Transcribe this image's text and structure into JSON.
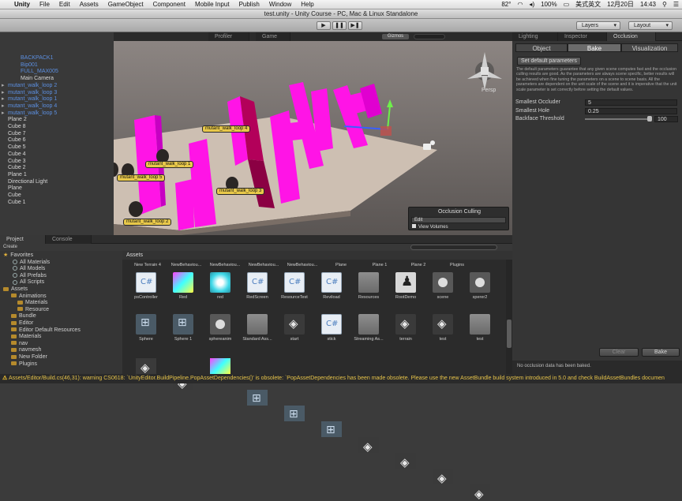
{
  "menubar": {
    "app": "Unity",
    "items": [
      "File",
      "Edit",
      "Assets",
      "GameObject",
      "Component",
      "Mobile Input",
      "Publish",
      "Window",
      "Help"
    ],
    "battery": "100%",
    "ime": "美式英文",
    "date": "12月20日",
    "time": "14:43",
    "temp": "82°"
  },
  "window": {
    "title": "test.unity - Unity Course - PC, Mac & Linux Standalone"
  },
  "toolbar": {
    "layers": "Layers",
    "layout": "Layout"
  },
  "hierarchy": {
    "items": [
      {
        "label": "BACKPACK1",
        "color": "blue",
        "indent": 1
      },
      {
        "label": "Bip001",
        "color": "blue",
        "indent": 1
      },
      {
        "label": "FULL_MAX005",
        "color": "blue",
        "indent": 1
      },
      {
        "label": "Main Camera",
        "color": "white",
        "indent": 1
      },
      {
        "label": "mutant_walk_loop 2",
        "color": "blue",
        "indent": 0
      },
      {
        "label": "mutant_walk_loop 3",
        "color": "blue",
        "indent": 0
      },
      {
        "label": "mutant_walk_loop 1",
        "color": "blue",
        "indent": 0
      },
      {
        "label": "mutant_walk_loop 4",
        "color": "blue",
        "indent": 0
      },
      {
        "label": "mutant_walk_loop 5",
        "color": "blue",
        "indent": 0
      },
      {
        "label": "Plane 2",
        "color": "white",
        "indent": 0
      },
      {
        "label": "Cube 8",
        "color": "white",
        "indent": 0
      },
      {
        "label": "Cube 7",
        "color": "white",
        "indent": 0
      },
      {
        "label": "Cube 6",
        "color": "white",
        "indent": 0
      },
      {
        "label": "Cube 5",
        "color": "white",
        "indent": 0
      },
      {
        "label": "Cube 4",
        "color": "white",
        "indent": 0
      },
      {
        "label": "Cube 3",
        "color": "white",
        "indent": 0
      },
      {
        "label": "Cube 2",
        "color": "white",
        "indent": 0
      },
      {
        "label": "Plane 1",
        "color": "white",
        "indent": 0
      },
      {
        "label": "Directional Light",
        "color": "white",
        "indent": 0
      },
      {
        "label": "Plane",
        "color": "white",
        "indent": 0
      },
      {
        "label": "Cube",
        "color": "white",
        "indent": 0
      },
      {
        "label": "Cube 1",
        "color": "white",
        "indent": 0
      }
    ]
  },
  "scene": {
    "tabs": [
      "Profiler",
      "Game"
    ],
    "gizmos": "Gizmos",
    "persp": "Persp",
    "labels": [
      "mutant_walk_loop 4",
      "mutant_walk_loop 1",
      "mutant_walk_loop 5",
      "mutant_walk_loop 3",
      "mutant_walk_loop 2"
    ],
    "occlusion": {
      "title": "Occlusion Culling",
      "mode": "Edit",
      "view_volumes": "View Volumes"
    }
  },
  "inspector": {
    "tabs": [
      "Lighting",
      "Inspector",
      "Occlusion"
    ],
    "subtabs": [
      "Object",
      "Bake",
      "Visualization"
    ],
    "set_default": "Set default parameters",
    "description": "The default parameters guarantee that any given scene computes fast and the occlusion culling results are good. As the parameters are always scene specific, better results will be achieved when fine tuning the parameters on a scene to scene basis. All the parameters are dependent on the unit scale of the scene and it is imperative that the unit scale parameter is set correctly before setting the default values.",
    "smallest_occluder_label": "Smallest Occluder",
    "smallest_occluder_value": "5",
    "smallest_hole_label": "Smallest Hole",
    "smallest_hole_value": "0.25",
    "backface_label": "Backface Threshold",
    "backface_value": "100",
    "clear": "Clear",
    "bake": "Bake",
    "no_data": "No occlusion data has been baked."
  },
  "project": {
    "tabs": [
      "Project",
      "Console"
    ],
    "create": "Create",
    "breadcrumb": "Assets",
    "favorites_title": "Favorites",
    "favorites": [
      "All Materials",
      "All Models",
      "All Prefabs",
      "All Scripts"
    ],
    "assets_title": "Assets",
    "folders": [
      "Animations",
      "Materials",
      "Resource",
      "Bundle",
      "Editor",
      "Editor Default Resources",
      "Materials",
      "nav",
      "navmesh",
      "New Folder",
      "Plugins"
    ],
    "top_row": [
      "New Terrain 4",
      "NewBehaviou...",
      "NewBehaviou...",
      "NewBehaviou...",
      "NewBehaviou...",
      "Plane",
      "Plane 1",
      "Plane 2",
      "Plugins"
    ],
    "row1": [
      {
        "name": "psController",
        "icon": "cs"
      },
      {
        "name": "Red",
        "icon": "mat"
      },
      {
        "name": "red",
        "icon": "ball"
      },
      {
        "name": "RedScreen",
        "icon": "cs"
      },
      {
        "name": "ResourceTest",
        "icon": "cs"
      },
      {
        "name": "Reviload",
        "icon": "cs"
      },
      {
        "name": "Resources",
        "icon": "folder"
      },
      {
        "name": "RootDemo",
        "icon": "person"
      },
      {
        "name": "scene",
        "icon": "audio"
      },
      {
        "name": "sperer2",
        "icon": "audio"
      }
    ],
    "row2": [
      {
        "name": "Sphere",
        "icon": "tree"
      },
      {
        "name": "Sphere 1",
        "icon": "tree"
      },
      {
        "name": "sphereanim",
        "icon": "audio"
      },
      {
        "name": "Standard Ass...",
        "icon": "folder"
      },
      {
        "name": "start",
        "icon": "unity"
      },
      {
        "name": "stick",
        "icon": "cs"
      },
      {
        "name": "Streaming As...",
        "icon": "folder"
      },
      {
        "name": "terrain",
        "icon": "unity"
      },
      {
        "name": "test",
        "icon": "unity"
      },
      {
        "name": "test",
        "icon": "folder"
      }
    ]
  },
  "status": {
    "message": "Assets/Editor/Build.cs(46,31): warning CS0618: `UnityEditor.BuildPipeline.PopAssetDependencies()' is obsolete: `PopAssetDependencies has been made obsolete. Please use the new AssetBundle build system introduced in 5.0 and check BuildAssetBundles documen"
  }
}
